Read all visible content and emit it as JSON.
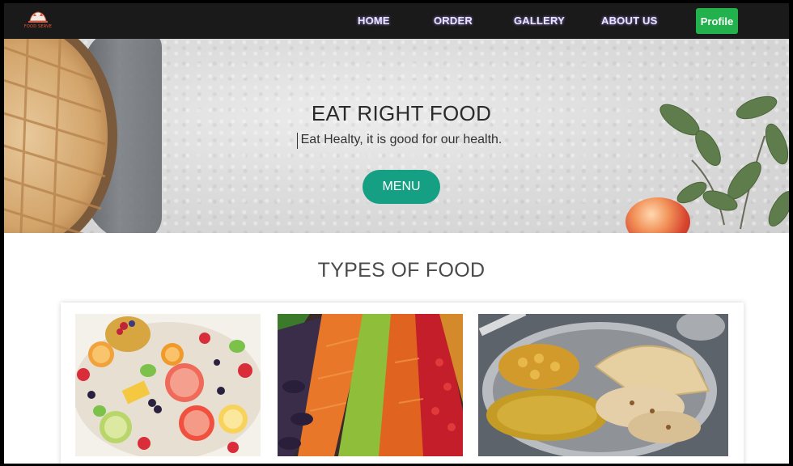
{
  "nav": {
    "logo_text": "FOOD SERVE",
    "links": [
      "HOME",
      "ORDER",
      "GALLERY",
      "ABOUT US"
    ],
    "profile_label": "Profile"
  },
  "hero": {
    "title": "EAT RIGHT FOOD",
    "subtitle": "Eat Healty, it is good for our health.",
    "menu_button": "MENU"
  },
  "types": {
    "title": "TYPES OF FOOD",
    "cards": [
      {
        "image": "fruit-platter-image"
      },
      {
        "image": "vegetables-image"
      },
      {
        "image": "thali-plate-image"
      }
    ]
  },
  "colors": {
    "navbar": "#1a1a1a",
    "profile_button": "#22b14c",
    "menu_button": "#16a083"
  }
}
